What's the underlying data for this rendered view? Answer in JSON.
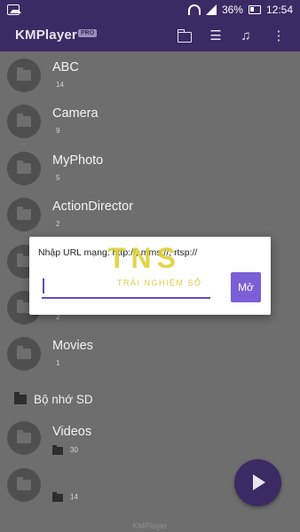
{
  "status": {
    "battery": "36%",
    "time": "12:54"
  },
  "appbar": {
    "title": "KMPlayer",
    "badge": "PRO"
  },
  "folders": [
    {
      "title": "ABC",
      "count": "14"
    },
    {
      "title": "Camera",
      "count": "9"
    },
    {
      "title": "MyPhoto",
      "count": "5"
    },
    {
      "title": "ActionDirector",
      "count": "2"
    },
    {
      "title": "",
      "count": ""
    },
    {
      "title": "",
      "count": "2"
    },
    {
      "title": "Movies",
      "count": "1"
    }
  ],
  "sd_section": {
    "label": "Bộ nhớ SD"
  },
  "sd_folders": [
    {
      "title": "Videos",
      "count": "30"
    },
    {
      "title": "",
      "count": "14"
    }
  ],
  "footer": {
    "text": "KMPlayer"
  },
  "dialog": {
    "label": "Nhập URL mạng: http://, mms://, rtsp://",
    "input_value": "",
    "button_label": "Mở"
  },
  "watermark": {
    "big": "TNS",
    "small": "TRẢI NGHIỆM SỐ"
  }
}
